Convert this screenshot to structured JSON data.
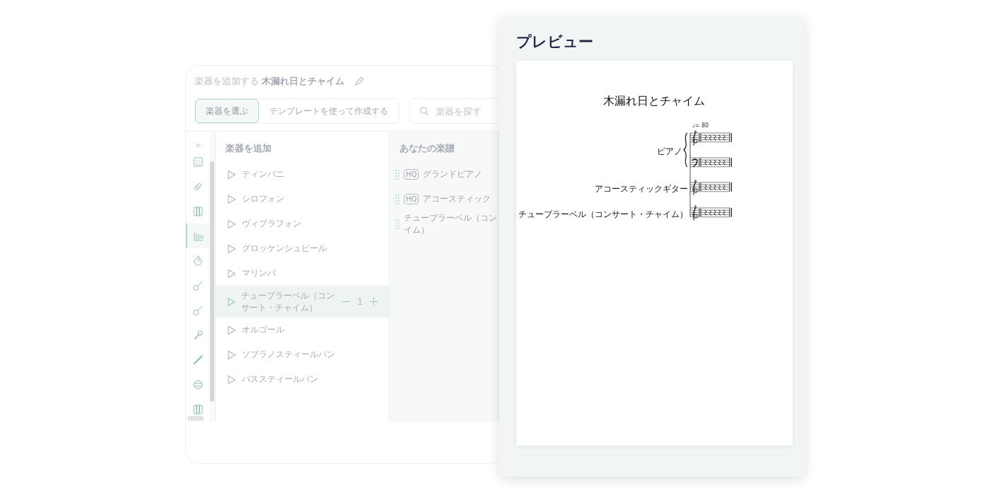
{
  "editor": {
    "title_prefix": "楽器を追加する",
    "score_name": "木漏れ日とチャイム",
    "modes": [
      {
        "label": "楽器を選ぶ",
        "selected": true
      },
      {
        "label": "テンプレートを使って作成する",
        "selected": false
      }
    ],
    "search": {
      "placeholder": "楽器を探す"
    },
    "categories": [
      {
        "kind": "score",
        "selected": false
      },
      {
        "kind": "xylophone",
        "selected": false
      },
      {
        "kind": "piano",
        "selected": false
      },
      {
        "kind": "bars",
        "selected": true
      },
      {
        "kind": "stopwatch",
        "selected": false
      },
      {
        "kind": "guitar",
        "selected": false
      },
      {
        "kind": "guitar",
        "selected": false
      },
      {
        "kind": "microphone",
        "selected": false
      },
      {
        "kind": "flute",
        "selected": false
      },
      {
        "kind": "drum",
        "selected": false
      },
      {
        "kind": "piano",
        "selected": false
      }
    ],
    "add_list": {
      "heading": "楽器を追加",
      "items": [
        {
          "name": "ティンパニ",
          "selected": false
        },
        {
          "name": "シロフォン",
          "selected": false
        },
        {
          "name": "ヴィブラフォン",
          "selected": false
        },
        {
          "name": "グロッケンシュピール",
          "selected": false
        },
        {
          "name": "マリンバ",
          "selected": false
        },
        {
          "name": "チューブラーベル（コンサート・チャイム）",
          "selected": true,
          "count": "1"
        },
        {
          "name": "オルゴール",
          "selected": false
        },
        {
          "name": "ソプラノスティールパン",
          "selected": false
        },
        {
          "name": "バススティールパン",
          "selected": false
        }
      ]
    },
    "score_list": {
      "heading": "あなたの楽譜",
      "items": [
        {
          "name": "グランドピアノ",
          "badge": "HQ"
        },
        {
          "name": "アコースティック",
          "badge": "HQ"
        },
        {
          "name": "チューブラーベル（コンイム）"
        }
      ]
    }
  },
  "preview": {
    "title": "プレビュー",
    "score": {
      "title": "木漏れ日とチャイム",
      "tempo": "♩= 80",
      "parts": [
        {
          "label": "ピアノ",
          "kind": "grand"
        },
        {
          "label": "アコースティックギター",
          "kind": "single"
        },
        {
          "label": "チューブラーベル（コンサート・チャイム）",
          "kind": "single"
        }
      ]
    }
  }
}
